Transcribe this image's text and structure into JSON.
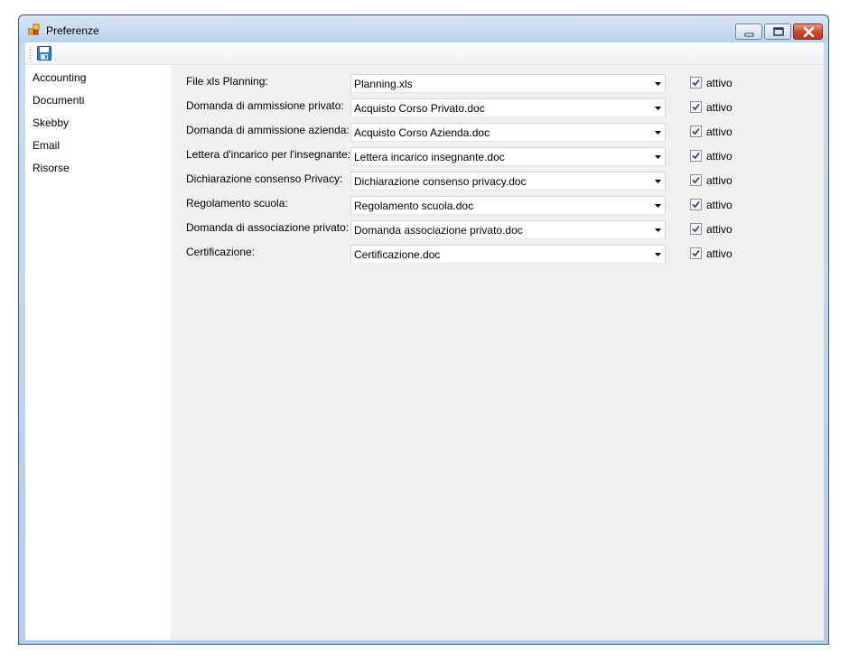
{
  "window": {
    "title": "Preferenze"
  },
  "toolbar": {
    "save_icon": "save-icon"
  },
  "sidebar": {
    "items": [
      {
        "label": "Accounting"
      },
      {
        "label": "Documenti"
      },
      {
        "label": "Skebby"
      },
      {
        "label": "Email"
      },
      {
        "label": "Risorse"
      }
    ]
  },
  "form": {
    "rows": [
      {
        "label": "File xls Planning:",
        "value": "Planning.xls",
        "checkbox_label": "attivo",
        "checked": true
      },
      {
        "label": "Domanda di ammissione privato:",
        "value": "Acquisto Corso Privato.doc",
        "checkbox_label": "attivo",
        "checked": true
      },
      {
        "label": "Domanda di ammissione azienda:",
        "value": "Acquisto Corso Azienda.doc",
        "checkbox_label": "attivo",
        "checked": true
      },
      {
        "label": "Lettera d'incarico per l'insegnante:",
        "value": "Lettera incarico insegnante.doc",
        "checkbox_label": "attivo",
        "checked": true
      },
      {
        "label": "Dichiarazione consenso Privacy:",
        "value": "Dichiarazione consenso privacy.doc",
        "checkbox_label": "attivo",
        "checked": true
      },
      {
        "label": "Regolamento scuola:",
        "value": "Regolamento scuola.doc",
        "checkbox_label": "attivo",
        "checked": true
      },
      {
        "label": "Domanda di associazione privato:",
        "value": "Domanda associazione privato.doc",
        "checkbox_label": "attivo",
        "checked": true
      },
      {
        "label": "Certificazione:",
        "value": "Certificazione.doc",
        "checkbox_label": "attivo",
        "checked": true
      }
    ]
  }
}
